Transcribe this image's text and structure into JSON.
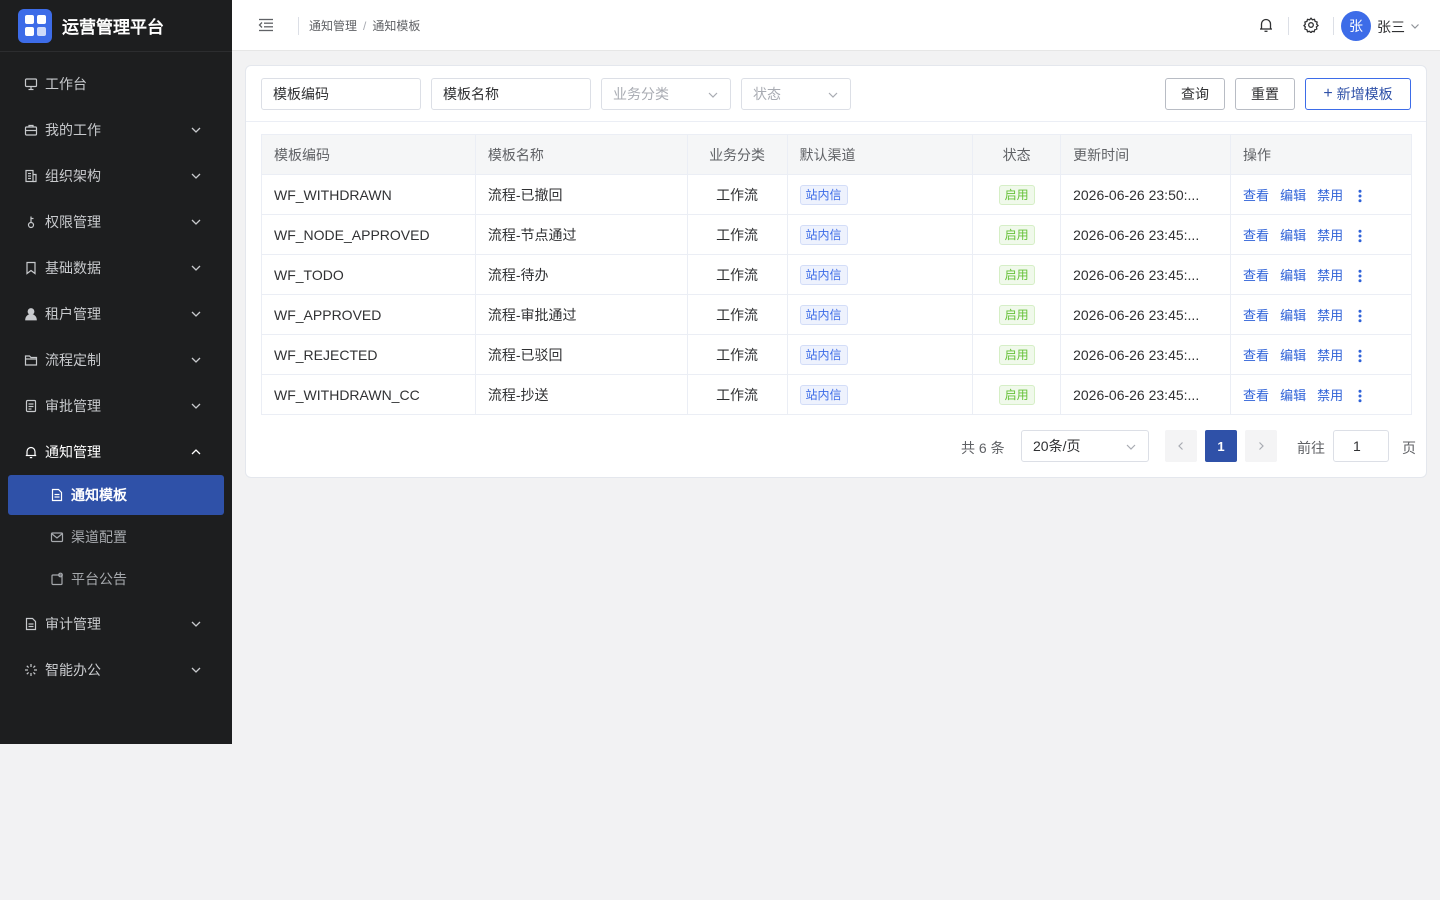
{
  "app": {
    "title": "运营管理平台",
    "brand_color": "#3d6ce8"
  },
  "sidebar": {
    "items": [
      {
        "label": "工作台",
        "icon": "dashboard-icon",
        "has_children": false
      },
      {
        "label": "我的工作",
        "icon": "briefcase-icon",
        "has_children": true
      },
      {
        "label": "组织架构",
        "icon": "building-icon",
        "has_children": true
      },
      {
        "label": "权限管理",
        "icon": "key-icon",
        "has_children": true
      },
      {
        "label": "基础数据",
        "icon": "bookmark-icon",
        "has_children": true
      },
      {
        "label": "租户管理",
        "icon": "user-icon",
        "has_children": true
      },
      {
        "label": "流程定制",
        "icon": "folder-icon",
        "has_children": true
      },
      {
        "label": "审批管理",
        "icon": "file-check-icon",
        "has_children": true
      },
      {
        "label": "通知管理",
        "icon": "bell-icon",
        "has_children": true,
        "expanded": true
      },
      {
        "label": "审计管理",
        "icon": "file-text-icon",
        "has_children": true
      },
      {
        "label": "智能办公",
        "icon": "sparkle-icon",
        "has_children": true
      }
    ],
    "notify_children": [
      {
        "label": "通知模板",
        "icon": "document-icon",
        "active": true
      },
      {
        "label": "渠道配置",
        "icon": "mail-icon",
        "active": false
      },
      {
        "label": "平台公告",
        "icon": "announcement-icon",
        "active": false
      }
    ]
  },
  "header": {
    "breadcrumb": [
      "通知管理",
      "通知模板"
    ],
    "user": {
      "avatar_text": "张",
      "name": "张三"
    }
  },
  "filters": {
    "code_placeholder": "模板编码",
    "name_placeholder": "模板名称",
    "category_placeholder": "业务分类",
    "status_placeholder": "状态",
    "query_label": "查询",
    "reset_label": "重置",
    "add_label": "新增模板"
  },
  "table": {
    "columns": [
      "模板编码",
      "模板名称",
      "业务分类",
      "默认渠道",
      "状态",
      "更新时间",
      "操作"
    ],
    "rows": [
      {
        "code": "WF_WITHDRAWN",
        "name": "流程-已撤回",
        "category": "工作流",
        "channel": "站内信",
        "status": "启用",
        "updated": "2026-06-26 23:50:..."
      },
      {
        "code": "WF_NODE_APPROVED",
        "name": "流程-节点通过",
        "category": "工作流",
        "channel": "站内信",
        "status": "启用",
        "updated": "2026-06-26 23:45:..."
      },
      {
        "code": "WF_TODO",
        "name": "流程-待办",
        "category": "工作流",
        "channel": "站内信",
        "status": "启用",
        "updated": "2026-06-26 23:45:..."
      },
      {
        "code": "WF_APPROVED",
        "name": "流程-审批通过",
        "category": "工作流",
        "channel": "站内信",
        "status": "启用",
        "updated": "2026-06-26 23:45:..."
      },
      {
        "code": "WF_REJECTED",
        "name": "流程-已驳回",
        "category": "工作流",
        "channel": "站内信",
        "status": "启用",
        "updated": "2026-06-26 23:45:..."
      },
      {
        "code": "WF_WITHDRAWN_CC",
        "name": "流程-抄送",
        "category": "工作流",
        "channel": "站内信",
        "status": "启用",
        "updated": "2026-06-26 23:45:..."
      }
    ],
    "actions": {
      "view": "查看",
      "edit": "编辑",
      "disable": "禁用"
    }
  },
  "pagination": {
    "total_text": "共 6 条",
    "page_size": "20条/页",
    "current_page": "1",
    "goto_label": "前往",
    "goto_value": "1",
    "page_unit": "页"
  }
}
